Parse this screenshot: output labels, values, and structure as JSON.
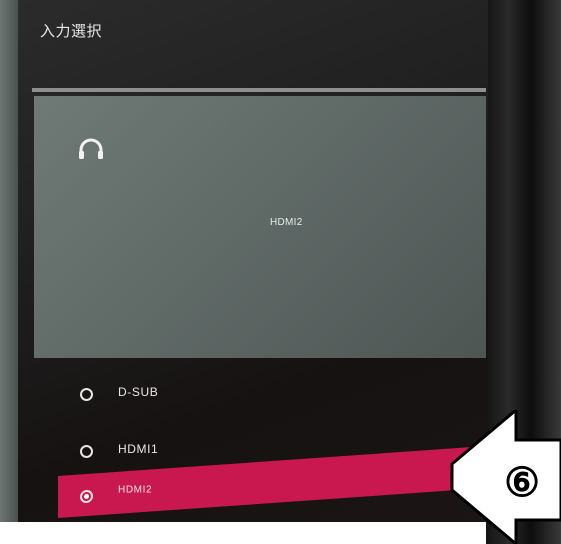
{
  "screen": {
    "title": "入力選択"
  },
  "preview": {
    "label": "HDMI2",
    "icon": "headphone-icon"
  },
  "inputs": [
    {
      "label": "D-SUB",
      "selected": false
    },
    {
      "label": "HDMI1",
      "selected": false
    },
    {
      "label": "HDMI2",
      "selected": true
    }
  ],
  "annotation": {
    "label": "⑥"
  },
  "colors": {
    "accent": "#c8184f",
    "preview_bg": "#66716e",
    "screen_bg": "#1e1e1e"
  }
}
